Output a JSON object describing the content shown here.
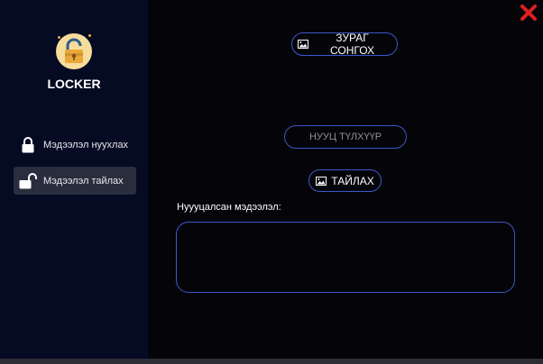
{
  "app": {
    "title": "LOCKER"
  },
  "sidebar": {
    "items": [
      {
        "label": "Мэдээлэл нуухлах",
        "icon": "lock-closed-icon",
        "active": false
      },
      {
        "label": "Мэдээлэл тайлах",
        "icon": "lock-open-icon",
        "active": true
      }
    ]
  },
  "main": {
    "choose_image_label": "ЗУРАГ СОНГОХ",
    "secret_key_placeholder": "НУУЦ ТҮЛХҮҮР",
    "decrypt_label": "ТАЙЛАХ",
    "hidden_info_label": "Нуууцалсан мэдээлэл:",
    "hidden_info_value": ""
  },
  "colors": {
    "sidebar_bg": "#060b24",
    "main_bg": "#050509",
    "accent_border": "#3b57c9",
    "close": "#e0201f",
    "logo_bg": "#f6dd9c"
  }
}
